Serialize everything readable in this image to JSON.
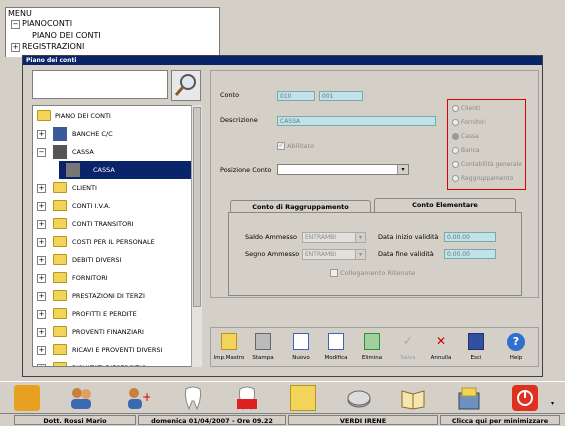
{
  "menu": {
    "title": "MENU",
    "items": [
      {
        "label": "PIANOCONTI"
      },
      {
        "label": "PIANO DEI CONTI"
      },
      {
        "label": "REGISTRAZIONI"
      }
    ]
  },
  "window": {
    "title": "Piano dei conti"
  },
  "tree": {
    "items": [
      {
        "label": "PIANO DEI CONTI"
      },
      {
        "label": "BANCHE C/C"
      },
      {
        "label": "CASSA"
      },
      {
        "label": "CASSA"
      },
      {
        "label": "CLIENTI"
      },
      {
        "label": "CONTI I.V.A."
      },
      {
        "label": "CONTI TRANSITORI"
      },
      {
        "label": "COSTI PER IL PERSONALE"
      },
      {
        "label": "DEBITI DIVERSI"
      },
      {
        "label": "FORNITORI"
      },
      {
        "label": "PRESTAZIONI DI TERZI"
      },
      {
        "label": "PROFITTI E PERDITE"
      },
      {
        "label": "PROVENTI FINANZIARI"
      },
      {
        "label": "RICAVI E PROVENTI DIVERSI"
      },
      {
        "label": "RISULTATI D'ESERCIZIO"
      }
    ]
  },
  "form": {
    "conto_label": "Conto",
    "conto_value1": "010",
    "conto_value2": "001",
    "descrizione_label": "Descrizione",
    "descrizione_value": "CASSA",
    "abilitato_label": "Abilitato",
    "posizione_label": "Posizione Conto",
    "posizione_value": ""
  },
  "radios": [
    {
      "label": "Clienti"
    },
    {
      "label": "Fornitori"
    },
    {
      "label": "Cassa"
    },
    {
      "label": "Banca"
    },
    {
      "label": "Contabilità generale"
    },
    {
      "label": "Raggruppamento"
    }
  ],
  "tabs": {
    "tab1": "Conto di Raggruppamento",
    "tab2": "Conto Elementare",
    "saldo_label": "Saldo Ammesso",
    "saldo_value": "ENTRAMBI",
    "segno_label": "Segno Ammesso",
    "segno_value": "ENTRAMBI",
    "data_inizio_label": "Data inizio validità",
    "data_inizio_value": "0.00.00",
    "data_fine_label": "Data fine validità",
    "data_fine_value": "0.00.00",
    "collegamento_label": "Collegamento Ritenute"
  },
  "toolbar": {
    "imp_mastro": "Imp.Mastro",
    "stampa": "Stampa",
    "nuovo": "Nuovo",
    "modifica": "Modifica",
    "elimina": "Elimina",
    "salva": "Salva",
    "annulla": "Annulla",
    "esci": "Esci",
    "help": "Help"
  },
  "status": {
    "user": "Dott. Rossi Mario",
    "date": "domenica 01/04/2007 - Ore 09.22",
    "patient": "VERDI IRENE",
    "minimize": "Clicca qui per minimizzare"
  },
  "colors": {
    "titlebar": "#0a246a",
    "selection": "#0a246a",
    "input_bg": "#bfe3e8",
    "radio_border": "#dd0000"
  }
}
